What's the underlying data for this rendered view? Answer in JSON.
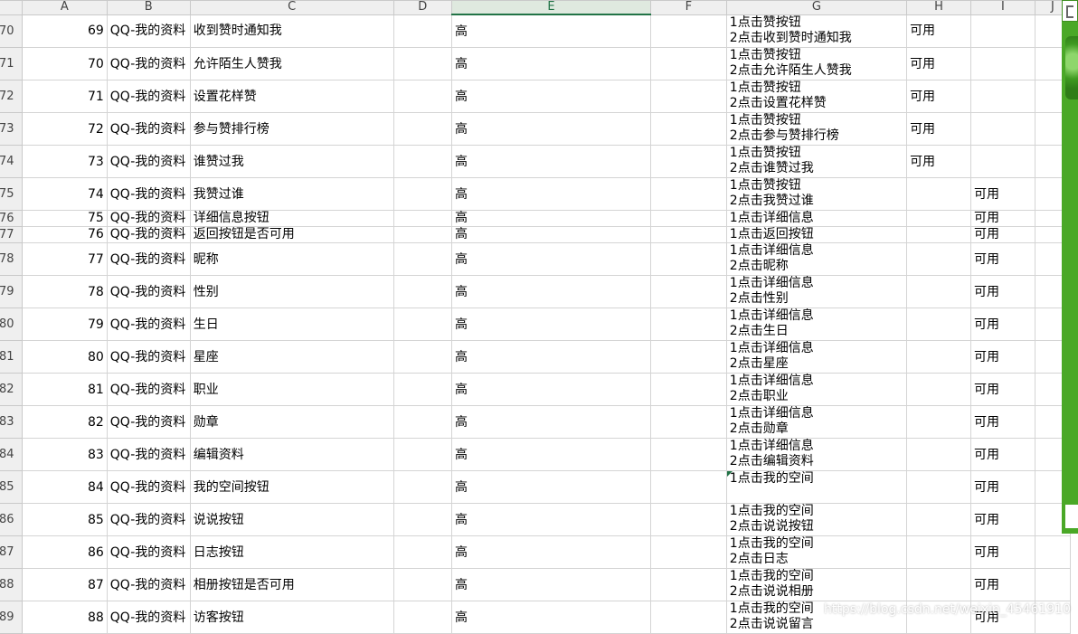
{
  "columns": [
    "A",
    "B",
    "C",
    "D",
    "E",
    "F",
    "G",
    "H",
    "I",
    "J"
  ],
  "active_column": "E",
  "rows": [
    {
      "row": "70",
      "id": "69",
      "module": "QQ-我的资料",
      "feature": "收到赞时通知我",
      "priority": "高",
      "steps": [
        "1点击赞按钮",
        "2点击收到赞时通知我"
      ],
      "h": "可用",
      "i": ""
    },
    {
      "row": "71",
      "id": "70",
      "module": "QQ-我的资料",
      "feature": "允许陌生人赞我",
      "priority": "高",
      "steps": [
        "1点击赞按钮",
        "2点击允许陌生人赞我"
      ],
      "h": "可用",
      "i": ""
    },
    {
      "row": "72",
      "id": "71",
      "module": "QQ-我的资料",
      "feature": "设置花样赞",
      "priority": "高",
      "steps": [
        "1点击赞按钮",
        "2点击设置花样赞"
      ],
      "h": "可用",
      "i": ""
    },
    {
      "row": "73",
      "id": "72",
      "module": "QQ-我的资料",
      "feature": "参与赞排行榜",
      "priority": "高",
      "steps": [
        "1点击赞按钮",
        "2点击参与赞排行榜"
      ],
      "h": "可用",
      "i": ""
    },
    {
      "row": "74",
      "id": "73",
      "module": "QQ-我的资料",
      "feature": "谁赞过我",
      "priority": "高",
      "steps": [
        "1点击赞按钮",
        "2点击谁赞过我"
      ],
      "h": "可用",
      "i": ""
    },
    {
      "row": "75",
      "id": "74",
      "module": "QQ-我的资料",
      "feature": "我赞过谁",
      "priority": "高",
      "steps": [
        "1点击赞按钮",
        "2点击我赞过谁"
      ],
      "h": "",
      "i": "可用"
    },
    {
      "row": "76",
      "id": "75",
      "module": "QQ-我的资料",
      "feature": "详细信息按钮",
      "priority": "高",
      "steps": [
        "1点击详细信息"
      ],
      "h": "",
      "i": "可用",
      "short": true
    },
    {
      "row": "77",
      "id": "76",
      "module": "QQ-我的资料",
      "feature": "返回按钮是否可用",
      "priority": "高",
      "steps": [
        "1点击返回按钮"
      ],
      "h": "",
      "i": "可用",
      "short": true
    },
    {
      "row": "78",
      "id": "77",
      "module": "QQ-我的资料",
      "feature": "昵称",
      "priority": "高",
      "steps": [
        "1点击详细信息",
        "2点击昵称"
      ],
      "h": "",
      "i": "可用"
    },
    {
      "row": "79",
      "id": "78",
      "module": "QQ-我的资料",
      "feature": "性别",
      "priority": "高",
      "steps": [
        "1点击详细信息",
        "2点击性别"
      ],
      "h": "",
      "i": "可用"
    },
    {
      "row": "80",
      "id": "79",
      "module": "QQ-我的资料",
      "feature": "生日",
      "priority": "高",
      "steps": [
        "1点击详细信息",
        "2点击生日"
      ],
      "h": "",
      "i": "可用"
    },
    {
      "row": "81",
      "id": "80",
      "module": "QQ-我的资料",
      "feature": "星座",
      "priority": "高",
      "steps": [
        "1点击详细信息",
        "2点击星座"
      ],
      "h": "",
      "i": "可用"
    },
    {
      "row": "82",
      "id": "81",
      "module": "QQ-我的资料",
      "feature": "职业",
      "priority": "高",
      "steps": [
        "1点击详细信息",
        "2点击职业"
      ],
      "h": "",
      "i": "可用"
    },
    {
      "row": "83",
      "id": "82",
      "module": "QQ-我的资料",
      "feature": "勋章",
      "priority": "高",
      "steps": [
        "1点击详细信息",
        "2点击勋章"
      ],
      "h": "",
      "i": "可用"
    },
    {
      "row": "84",
      "id": "83",
      "module": "QQ-我的资料",
      "feature": "编辑资料",
      "priority": "高",
      "steps": [
        "1点击详细信息",
        "2点击编辑资料"
      ],
      "h": "",
      "i": "可用"
    },
    {
      "row": "85",
      "id": "84",
      "module": "QQ-我的资料",
      "feature": "我的空间按钮",
      "priority": "高",
      "steps": [
        "1点击我的空间"
      ],
      "h": "",
      "i": "可用",
      "comment": true
    },
    {
      "row": "86",
      "id": "85",
      "module": "QQ-我的资料",
      "feature": "说说按钮",
      "priority": "高",
      "steps": [
        "1点击我的空间",
        "2点击说说按钮"
      ],
      "h": "",
      "i": "可用"
    },
    {
      "row": "87",
      "id": "86",
      "module": "QQ-我的资料",
      "feature": "日志按钮",
      "priority": "高",
      "steps": [
        "1点击我的空间",
        "2点击日志"
      ],
      "h": "",
      "i": "可用"
    },
    {
      "row": "88",
      "id": "87",
      "module": "QQ-我的资料",
      "feature": "相册按钮是否可用",
      "priority": "高",
      "steps": [
        "1点击我的空间",
        "2点击说说相册"
      ],
      "h": "",
      "i": "可用"
    },
    {
      "row": "89",
      "id": "88",
      "module": "QQ-我的资料",
      "feature": "访客按钮",
      "priority": "高",
      "steps": [
        "1点击我的空间",
        "2点击说说留言"
      ],
      "h": "",
      "i": "可用"
    }
  ],
  "watermark": "https://blog.csdn.net/weixin_45461910",
  "colors": {
    "accent": "#217346",
    "side_panel": "#4aa827"
  }
}
